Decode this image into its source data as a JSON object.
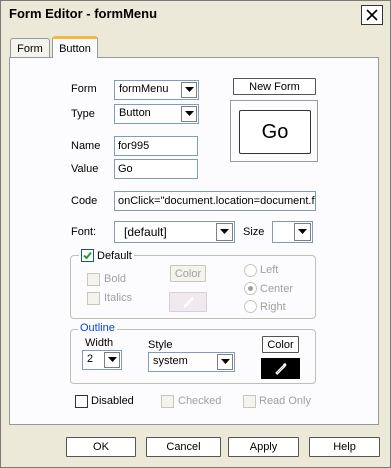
{
  "window": {
    "title": "Form Editor - formMenu"
  },
  "tabs": [
    {
      "label": "Form"
    },
    {
      "label": "Button"
    }
  ],
  "fields": {
    "form_label": "Form",
    "form_value": "formMenu",
    "type_label": "Type",
    "type_value": "Button",
    "name_label": "Name",
    "name_value": "for995",
    "value_label": "Value",
    "value_value": "Go",
    "code_label": "Code",
    "code_value": "onClick=\"document.location=document.f",
    "font_label": "Font:",
    "font_value": "[default]",
    "size_label": "Size",
    "size_value": ""
  },
  "preview": {
    "new_form_label": "New Form",
    "button_text": "Go"
  },
  "default_group": {
    "label": "Default",
    "checked": true,
    "bold_label": "Bold",
    "italics_label": "Italics",
    "color_label": "Color",
    "left_label": "Left",
    "center_label": "Center",
    "right_label": "Right",
    "selected_alignment": "Center"
  },
  "outline_group": {
    "label": "Outline",
    "width_label": "Width",
    "width_value": "2",
    "style_label": "Style",
    "style_value": "system",
    "color_label": "Color"
  },
  "options": {
    "disabled_label": "Disabled",
    "checked_label": "Checked",
    "readonly_label": "Read Only"
  },
  "footer": {
    "ok": "OK",
    "cancel": "Cancel",
    "apply": "Apply",
    "help": "Help"
  },
  "colors": {
    "accent_tab": "#f5b93f",
    "group_legend": "#0046d5",
    "swatch_dark": "#000000"
  },
  "icons": [
    "close-icon",
    "chevron-down-icon",
    "checkmark-icon",
    "pen-icon"
  ]
}
